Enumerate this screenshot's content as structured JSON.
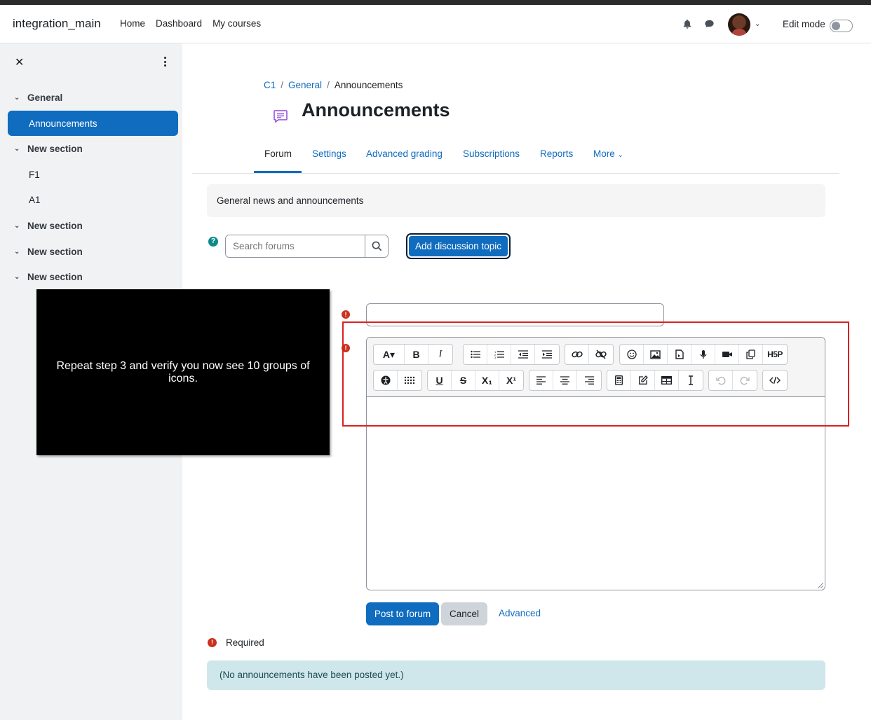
{
  "navbar": {
    "brand": "integration_main",
    "links": [
      "Home",
      "Dashboard",
      "My courses"
    ],
    "edit_mode_label": "Edit mode",
    "edit_mode_on": false
  },
  "drawer": {
    "items": [
      {
        "label": "General",
        "type": "section"
      },
      {
        "label": "Announcements",
        "type": "active"
      },
      {
        "label": "New section",
        "type": "section"
      },
      {
        "label": "F1",
        "type": "child"
      },
      {
        "label": "A1",
        "type": "child"
      },
      {
        "label": "New section",
        "type": "section"
      },
      {
        "label": "New section",
        "type": "section"
      },
      {
        "label": "New section",
        "type": "section"
      }
    ]
  },
  "breadcrumb": {
    "items": [
      "C1",
      "General",
      "Announcements"
    ]
  },
  "page": {
    "title": "Announcements"
  },
  "tabs": [
    "Forum",
    "Settings",
    "Advanced grading",
    "Subscriptions",
    "Reports",
    "More"
  ],
  "intro": "General news and announcements",
  "search": {
    "placeholder": "Search forums"
  },
  "add_discussion_label": "Add discussion topic",
  "editor": {
    "toolbar_row1": [
      [
        "A▾",
        "B",
        "I"
      ],
      [
        "list-ul",
        "list-ol",
        "outdent",
        "indent"
      ],
      [
        "link",
        "unlink"
      ],
      [
        "emoji",
        "image",
        "media",
        "record-audio",
        "record-video",
        "manage-files",
        "H5P"
      ]
    ],
    "toolbar_row2": [
      [
        "accessibility",
        "screenreader"
      ],
      [
        "U",
        "S",
        "X₁",
        "X¹"
      ],
      [
        "align-left",
        "align-center",
        "align-right"
      ],
      [
        "equation",
        "edit",
        "table",
        "clear-format"
      ],
      [
        "undo",
        "redo"
      ],
      [
        "html"
      ]
    ]
  },
  "actions": {
    "post": "Post to forum",
    "cancel": "Cancel",
    "advanced": "Advanced"
  },
  "required_label": "Required",
  "notice": "(No announcements have been posted yet.)",
  "overlay": {
    "text": "Repeat step 3 and verify you now see 10 groups of icons."
  },
  "colors": {
    "primary": "#0f6cbf",
    "highlight": "#d9211e",
    "error": "#ca3120",
    "notice_bg": "#cfe7ea"
  }
}
